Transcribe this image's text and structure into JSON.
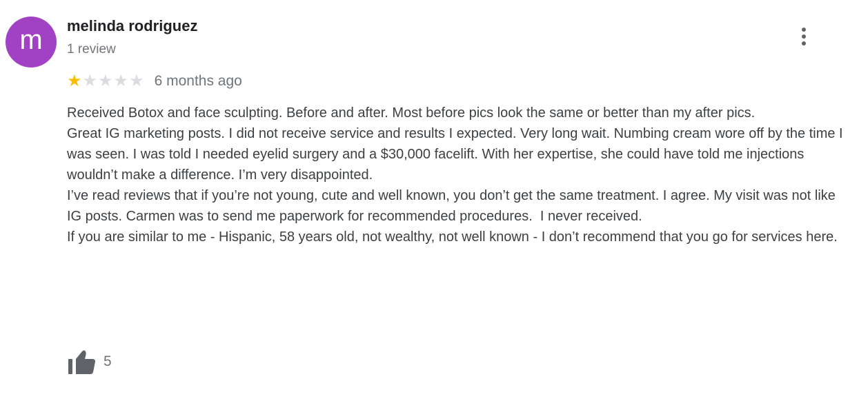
{
  "review": {
    "author_name": "melinda rodriguez",
    "avatar_letter": "m",
    "review_count": "1 review",
    "rating": 1,
    "rating_max": 5,
    "date": "6 months ago",
    "text": "Received Botox and face sculpting. Before and after. Most before pics look the same or better than my after pics.\nGreat IG marketing posts. I did not receive service and results I expected. Very long wait. Numbing cream wore off by the time I was seen. I was told I needed eyelid surgery and a $30,000 facelift. With her expertise, she could have told me injections wouldn’t make a difference. I’m very disappointed.\nI’ve read reviews that if you’re not young, cute and well known, you don’t get the same treatment. I agree. My visit was not like IG posts. Carmen was to send me paperwork for recommended procedures.  I never received.\nIf you are similar to me - Hispanic, 58 years old, not wealthy, not well known - I don’t recommend that you go for services here.",
    "like_count": "5",
    "icons": {
      "more": "more-vert-icon",
      "like": "thumbs-up-icon"
    }
  },
  "colors": {
    "avatar_bg": "#a142c4",
    "star_filled": "#fbbc04",
    "star_empty": "#dadce0",
    "like_icon": "#5f6368"
  }
}
